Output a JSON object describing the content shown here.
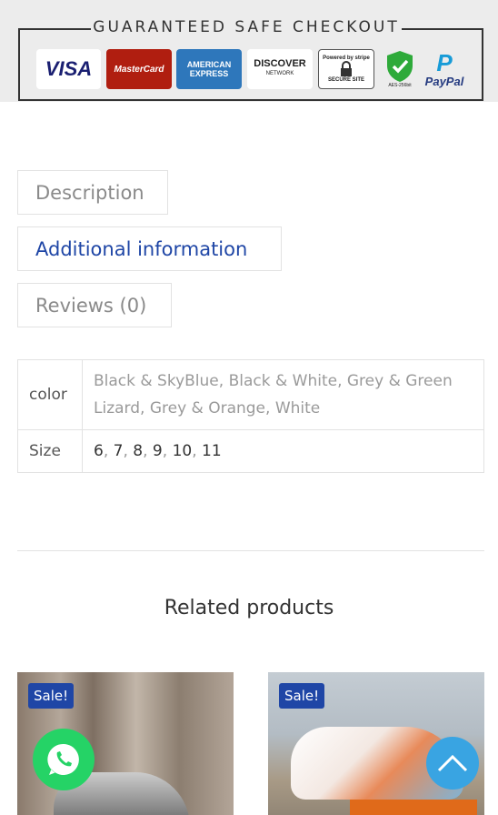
{
  "checkout": {
    "title": "GUARANTEED SAFE CHECKOUT",
    "badges": {
      "visa": "VISA",
      "mastercard": "MasterCard",
      "amex_line1": "AMERICAN",
      "amex_line2": "EXPRESS",
      "discover": "DISCOVER",
      "discover_sub": "NETWORK",
      "stripe_top": "Powered by stripe",
      "stripe_bottom": "SECURE SITE",
      "aes": "AES-256bit",
      "paypal": "PayPal"
    }
  },
  "tabs": [
    {
      "label": "Description"
    },
    {
      "label": "Additional information"
    },
    {
      "label": "Reviews (0)"
    }
  ],
  "attributes": {
    "color_label": "color",
    "color_value": "Black & SkyBlue, Black & White, Grey & Green Lizard, Grey & Orange, White",
    "size_label": "Size",
    "sizes": [
      "6",
      "7",
      "8",
      "9",
      "10",
      "11"
    ]
  },
  "related": {
    "title": "Related products",
    "products": [
      {
        "badge": "Sale!"
      },
      {
        "badge": "Sale!"
      }
    ]
  },
  "colors": {
    "accent": "#1f46a6",
    "whatsapp": "#25d366",
    "scroll_top": "#39a4e2"
  }
}
